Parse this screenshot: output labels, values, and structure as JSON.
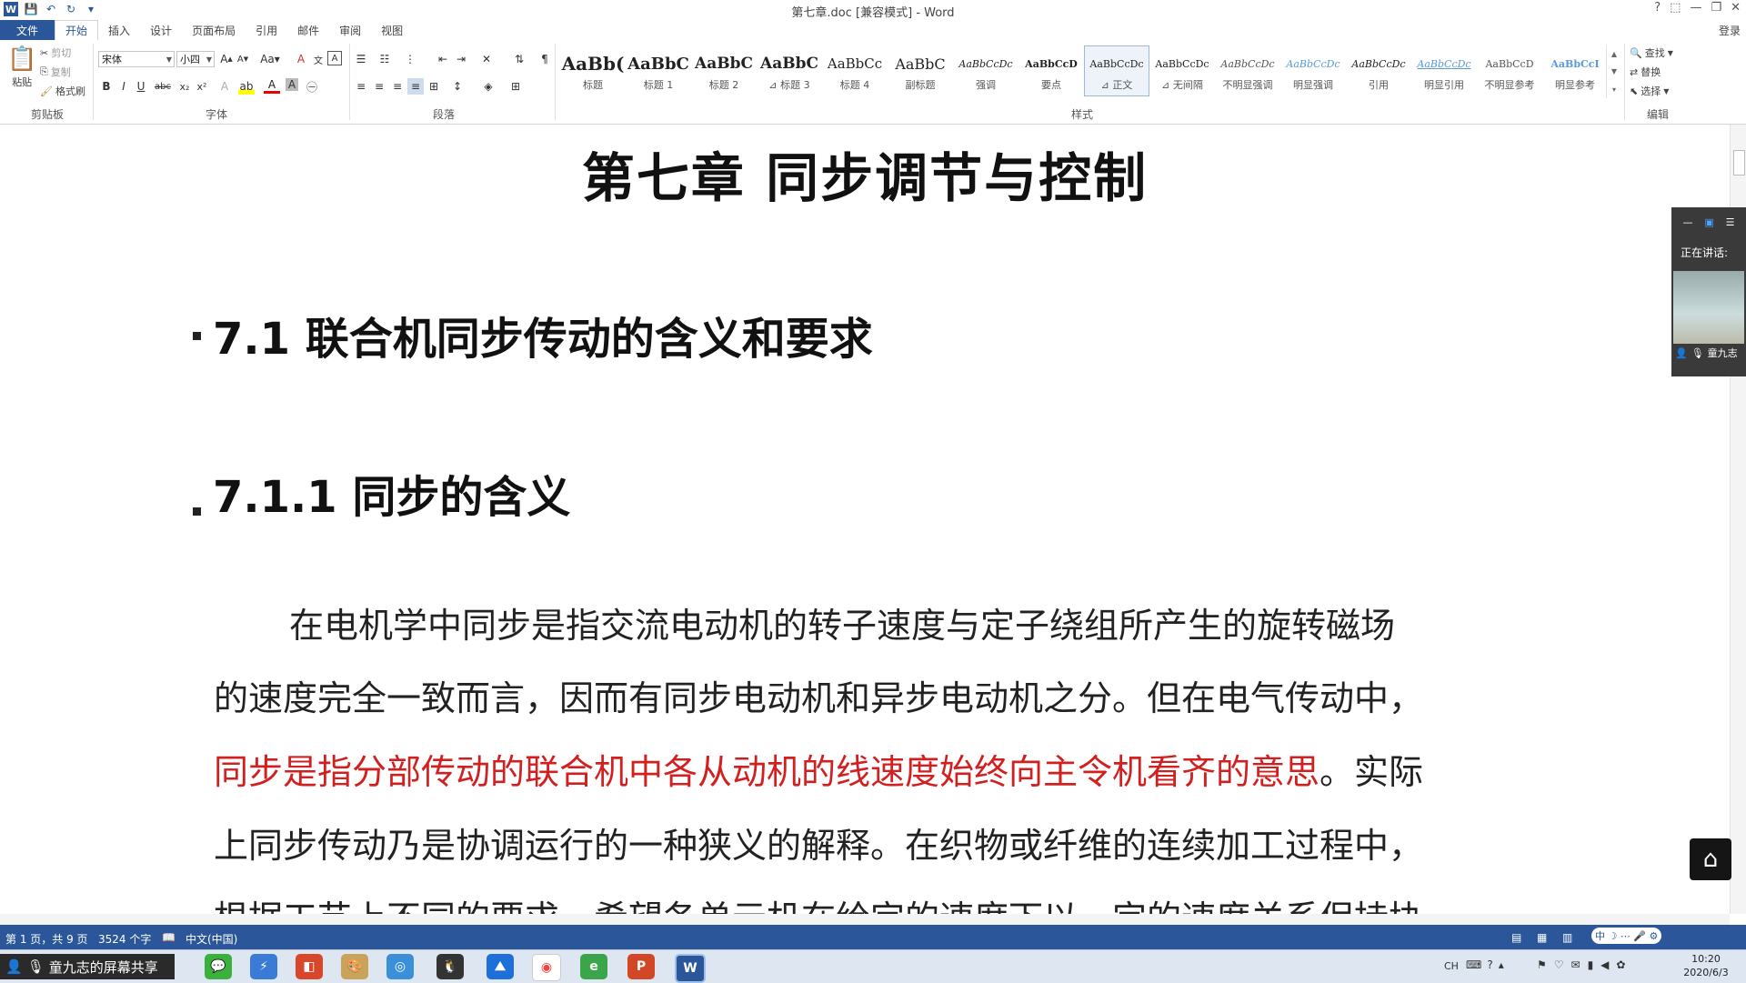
{
  "window": {
    "title": "第七章.doc [兼容模式] - Word",
    "controls": [
      "?",
      "⬚",
      "—",
      "❐",
      "✕"
    ],
    "sign_in": "登录"
  },
  "tabs": [
    "文件",
    "开始",
    "插入",
    "设计",
    "页面布局",
    "引用",
    "邮件",
    "审阅",
    "视图"
  ],
  "active_tab": "开始",
  "ribbon": {
    "clipboard": {
      "paste": "粘贴",
      "cut": "剪切",
      "copy": "复制",
      "format_painter": "格式刷",
      "label": "剪贴板"
    },
    "font": {
      "name": "宋体",
      "size": "小四",
      "label": "字体"
    },
    "paragraph": {
      "label": "段落"
    },
    "styles": {
      "label": "样式",
      "items": [
        {
          "sample": "AaBb(",
          "name": "标题"
        },
        {
          "sample": "AaBbC",
          "name": "标题 1"
        },
        {
          "sample": "AaBbC",
          "name": "标题 2"
        },
        {
          "sample": "AaBbC",
          "name": "⊿ 标题 3"
        },
        {
          "sample": "AaBbCc",
          "name": "标题 4"
        },
        {
          "sample": "AaBbC",
          "name": "副标题"
        },
        {
          "sample": "AaBbCcDc",
          "name": "强调"
        },
        {
          "sample": "AaBbCcD",
          "name": "要点"
        },
        {
          "sample": "AaBbCcDc",
          "name": "⊿ 正文"
        },
        {
          "sample": "AaBbCcDc",
          "name": "⊿ 无间隔"
        },
        {
          "sample": "AaBbCcDc",
          "name": "不明显强调"
        },
        {
          "sample": "AaBbCcDc",
          "name": "明显强调"
        },
        {
          "sample": "AaBbCcDc",
          "name": "引用"
        },
        {
          "sample": "AaBbCcDc",
          "name": "明显引用"
        },
        {
          "sample": "AaBbCcD",
          "name": "不明显参考"
        },
        {
          "sample": "AaBbCcI",
          "name": "明显参考"
        }
      ],
      "selected": "⊿ 正文"
    },
    "editing": {
      "find": "查找",
      "replace": "替换",
      "select": "选择",
      "label": "编辑"
    }
  },
  "document": {
    "chapter_title": "第七章  同步调节与控制",
    "heading1": "7.1  联合机同步传动的含义和要求",
    "heading2": "7.1.1 同步的含义",
    "para_line1": "在电机学中同步是指交流电动机的转子速度与定子绕组所产生的旋转磁场",
    "para_line2": "的速度完全一致而言，因而有同步电动机和异步电动机之分。但在电气传动中，",
    "para_line3_red": "同步是指分部传动的联合机中各从动机的线速度始终向主令机看齐的意思",
    "para_line3_rest": "。实际",
    "para_line4": "上同步传动乃是协调运行的一种狭义的解释。在织物或纤维的连续加工过程中，",
    "para_line5_partial": "根据工艺上不同的要求，希望各单元机在给定的速度下以一定的速度关系保持协"
  },
  "status_bar": {
    "page": "第 1 页，共 9 页",
    "words": "3524 个字",
    "language": "中文(中国)"
  },
  "speaker_panel": {
    "speaking_label": "正在讲话:",
    "name": "童九志"
  },
  "taskbar": {
    "share_label": "童九志的屏幕共享",
    "time": "10:20",
    "date": "2020/6/3",
    "ime": "中",
    "lang": "CH"
  },
  "colors": {
    "word_blue": "#2b579a",
    "highlight_red": "#d21f1f"
  }
}
